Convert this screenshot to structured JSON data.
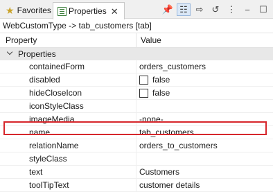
{
  "tabs": {
    "favorites": "Favorites",
    "properties": "Properties"
  },
  "breadcrumb": "WebCustomType -> tab_customers [tab]",
  "columns": {
    "property": "Property",
    "value": "Value"
  },
  "group": "Properties",
  "rows": [
    {
      "name": "containedForm",
      "value": "orders_customers"
    },
    {
      "name": "disabled",
      "value": "false"
    },
    {
      "name": "hideCloseIcon",
      "value": "false"
    },
    {
      "name": "iconStyleClass",
      "value": ""
    },
    {
      "name": "imageMedia",
      "value": "-none-"
    },
    {
      "name": "name",
      "value": "tab_customers"
    },
    {
      "name": "relationName",
      "value": "orders_to_customers"
    },
    {
      "name": "styleClass",
      "value": ""
    },
    {
      "name": "text",
      "value": "Customers"
    },
    {
      "name": "toolTipText",
      "value": "customer details"
    }
  ],
  "colors": {
    "highlight": "#d6262b",
    "group_bg": "#e8e8e8"
  }
}
